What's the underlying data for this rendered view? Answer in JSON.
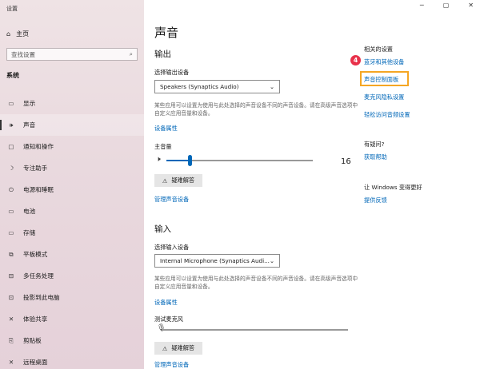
{
  "window": {
    "title": "设置",
    "controls": {
      "minimize": "─",
      "maximize": "▢",
      "close": "✕"
    }
  },
  "sidebar": {
    "home": "主页",
    "search_placeholder": "查找设置",
    "section": "系统",
    "items": [
      {
        "label": "显示",
        "icon": "monitor-icon",
        "glyph": "▭"
      },
      {
        "label": "声音",
        "icon": "speaker-icon",
        "glyph": "🕪"
      },
      {
        "label": "通知和操作",
        "icon": "notification-icon",
        "glyph": "▢"
      },
      {
        "label": "专注助手",
        "icon": "moon-icon",
        "glyph": "☽"
      },
      {
        "label": "电源和睡眠",
        "icon": "power-icon",
        "glyph": "⏻"
      },
      {
        "label": "电池",
        "icon": "battery-icon",
        "glyph": "▭"
      },
      {
        "label": "存储",
        "icon": "storage-icon",
        "glyph": "▭"
      },
      {
        "label": "平板模式",
        "icon": "tablet-icon",
        "glyph": "⧉"
      },
      {
        "label": "多任务处理",
        "icon": "multitask-icon",
        "glyph": "⊟"
      },
      {
        "label": "投影到此电脑",
        "icon": "project-icon",
        "glyph": "⊡"
      },
      {
        "label": "体验共享",
        "icon": "share-icon",
        "glyph": "✕"
      },
      {
        "label": "剪贴板",
        "icon": "clipboard-icon",
        "glyph": "⎘"
      },
      {
        "label": "远程桌面",
        "icon": "remote-icon",
        "glyph": "✕"
      }
    ],
    "active_index": 1
  },
  "main": {
    "title": "声音",
    "output": {
      "heading": "输出",
      "device_label": "选择输出设备",
      "device_value": "Speakers (Synaptics Audio)",
      "description": "某些应用可以设置为使用与此处选择的声音设备不同的声音设备。请在高级声音选项中自定义应用音量和设备。",
      "properties_link": "设备属性",
      "volume_label": "主音量",
      "volume": 16,
      "troubleshoot": "疑难解答",
      "manage_link": "管理声音设备"
    },
    "input": {
      "heading": "输入",
      "device_label": "选择输入设备",
      "device_value": "Internal Microphone (Synaptics Audi...",
      "description": "某些应用可以设置为使用与此处选择的声音设备不同的声音设备。请在高级声音选项中自定义应用音量和设备。",
      "properties_link": "设备属性",
      "test_label": "测试麦克风",
      "troubleshoot": "疑难解答",
      "manage_link": "管理声音设备"
    }
  },
  "related": {
    "heading": "相关的设置",
    "links": [
      "蓝牙和其他设备",
      "声音控制面板",
      "麦克风隐私设置",
      "轻松访问音频设置"
    ],
    "step_badge": "4",
    "help_heading": "有疑问?",
    "help_link": "获取帮助",
    "improve_heading": "让 Windows 变得更好",
    "feedback_link": "提供反馈"
  }
}
